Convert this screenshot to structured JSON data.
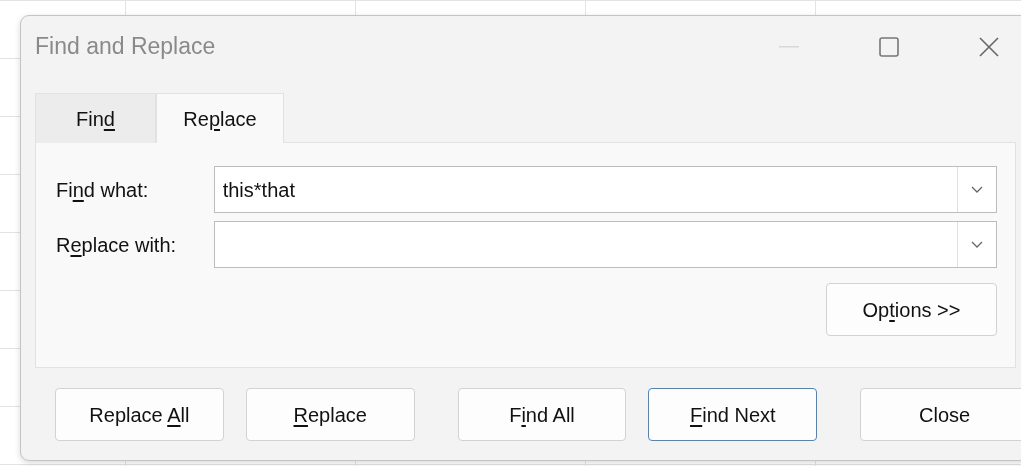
{
  "window": {
    "title": "Find and Replace"
  },
  "tabs": [
    {
      "label": {
        "pre": "Fin",
        "key": "d"
      },
      "selected": false
    },
    {
      "label": {
        "pre": "Re",
        "key": "p",
        "post": "lace"
      },
      "selected": true
    }
  ],
  "fields": [
    {
      "label": {
        "pre": "Fi",
        "key": "n",
        "post": "d what:"
      },
      "value": "this*that"
    },
    {
      "label": {
        "pre": "R",
        "key": "e",
        "post": "place with:"
      }
    }
  ],
  "options_button": {
    "label": {
      "pre": "Op",
      "key": "t",
      "post": "ions >>"
    }
  },
  "buttons": [
    {
      "label": {
        "pre": "Replace ",
        "key": "A",
        "post": "ll"
      },
      "default": false
    },
    {
      "label": {
        "key": "R",
        "post": "eplace"
      },
      "default": false
    },
    {
      "label": {
        "pre": "F",
        "key": "i",
        "post": "nd All"
      },
      "default": false
    },
    {
      "label": {
        "key": "F",
        "post": "ind Next"
      },
      "default": true
    },
    {
      "label": {
        "pre": "Close"
      },
      "default": false
    }
  ]
}
